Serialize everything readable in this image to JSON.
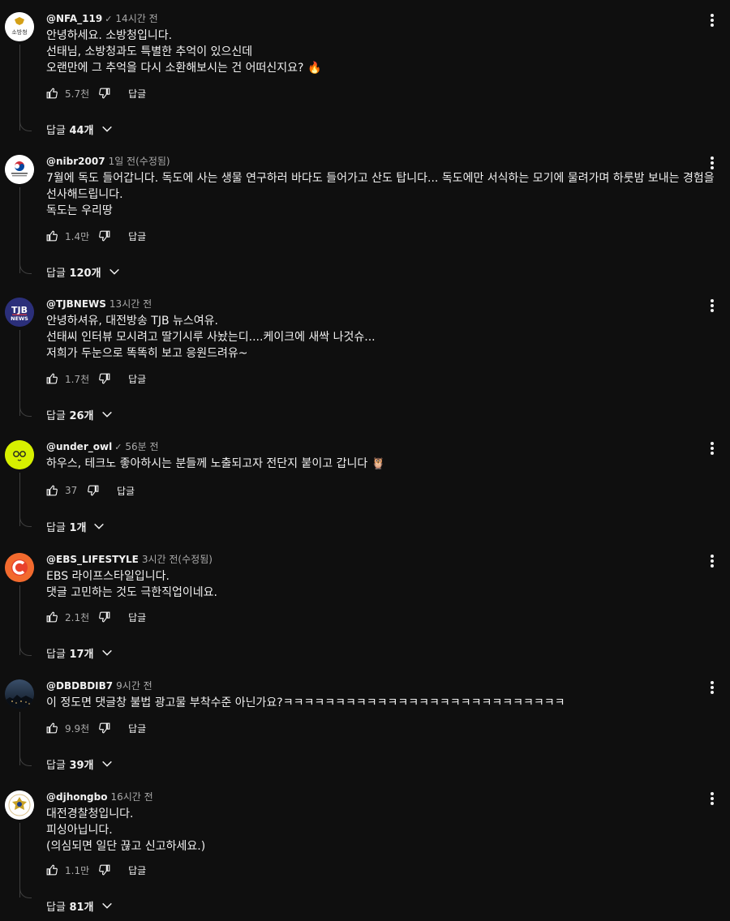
{
  "labels": {
    "reply": "답글"
  },
  "comments": [
    {
      "author": "@NFA_119",
      "verified": true,
      "time": "14시간 전",
      "lines": [
        "안녕하세요. 소방청입니다.",
        "선태님, 소방청과도 특별한 추억이 있으신데",
        "오랜만에 그 추억을 다시 소환해보시는 건 어떠신지요? 🔥"
      ],
      "likes": "5.7천",
      "replies_prefix": "답글",
      "replies_count": "44개",
      "avatar": {
        "bg": "#ffffff",
        "text": "소방청",
        "color": "#333333",
        "accent": "#d4a017"
      }
    },
    {
      "author": "@nibr2007",
      "verified": false,
      "time": "1일 전(수정됨)",
      "lines": [
        "7월에 독도 들어갑니다. 독도에 사는 생물 연구하러 바다도 들어가고 산도 탑니다... 독도에만 서식하는 모기에 물려가며 하룻밤 보내는 경험을",
        "선사해드립니다.",
        "독도는 우리땅"
      ],
      "likes": "1.4만",
      "replies_prefix": "답글",
      "replies_count": "120개",
      "avatar": {
        "bg": "#ffffff",
        "text": "",
        "color": "#0047a0",
        "accent": "#cd2e3a"
      }
    },
    {
      "author": "@TJBNEWS",
      "verified": false,
      "time": "13시간 전",
      "lines": [
        "안녕하셔유, 대전방송 TJB 뉴스여유.",
        "선태씨 인터뷰 모시려고 딸기시루 사놨는디....케이크에 새싹 나것슈...",
        "저희가 두눈으로 똑똑히 보고 응원드려유~"
      ],
      "likes": "1.7천",
      "replies_prefix": "답글",
      "replies_count": "26개",
      "avatar": {
        "bg": "#2b2f7a",
        "text": "TJB",
        "color": "#ffffff",
        "accent": "#e03a3e"
      }
    },
    {
      "author": "@under_owl",
      "verified": true,
      "time": "56분 전",
      "lines": [
        "하우스, 테크노 좋아하시는 분들께 노출되고자 전단지 붙이고 갑니다 🦉"
      ],
      "likes": "37",
      "replies_prefix": "답글",
      "replies_count": "1개",
      "avatar": {
        "bg": "#d7f000",
        "text": "owl",
        "color": "#222222",
        "accent": "#222222"
      }
    },
    {
      "author": "@EBS_LIFESTYLE",
      "verified": false,
      "time": "3시간 전(수정됨)",
      "lines": [
        "EBS 라이프스타일입니다.",
        "댓글 고민하는 것도 극한직업이네요."
      ],
      "likes": "2.1천",
      "replies_prefix": "답글",
      "replies_count": "17개",
      "avatar": {
        "bg": "#f26a2e",
        "text": "C",
        "color": "#ffffff",
        "accent": "#e8412c"
      }
    },
    {
      "author": "@DBDBDIB7",
      "verified": false,
      "time": "9시간 전",
      "lines": [
        "이 정도면 댓글창 불법 광고물 부착수준 아닌가요?ㅋㅋㅋㅋㅋㅋㅋㅋㅋㅋㅋㅋㅋㅋㅋㅋㅋㅋㅋㅋㅋㅋㅋㅋㅋㅋㅋ"
      ],
      "likes": "9.9천",
      "replies_prefix": "답글",
      "replies_count": "39개",
      "avatar": {
        "bg": "#1d2a3a",
        "text": "",
        "color": "#ffffff",
        "accent": "#c8a060"
      }
    },
    {
      "author": "@djhongbo",
      "verified": false,
      "time": "16시간 전",
      "lines": [
        "대전경찰청입니다.",
        "피싱아닙니다.",
        "(의심되면 일단 끊고 신고하세요.)"
      ],
      "likes": "1.1만",
      "replies_prefix": "답글",
      "replies_count": "81개",
      "avatar": {
        "bg": "#ffffff",
        "text": "",
        "color": "#b8860b",
        "accent": "#1b3d8a"
      }
    }
  ]
}
